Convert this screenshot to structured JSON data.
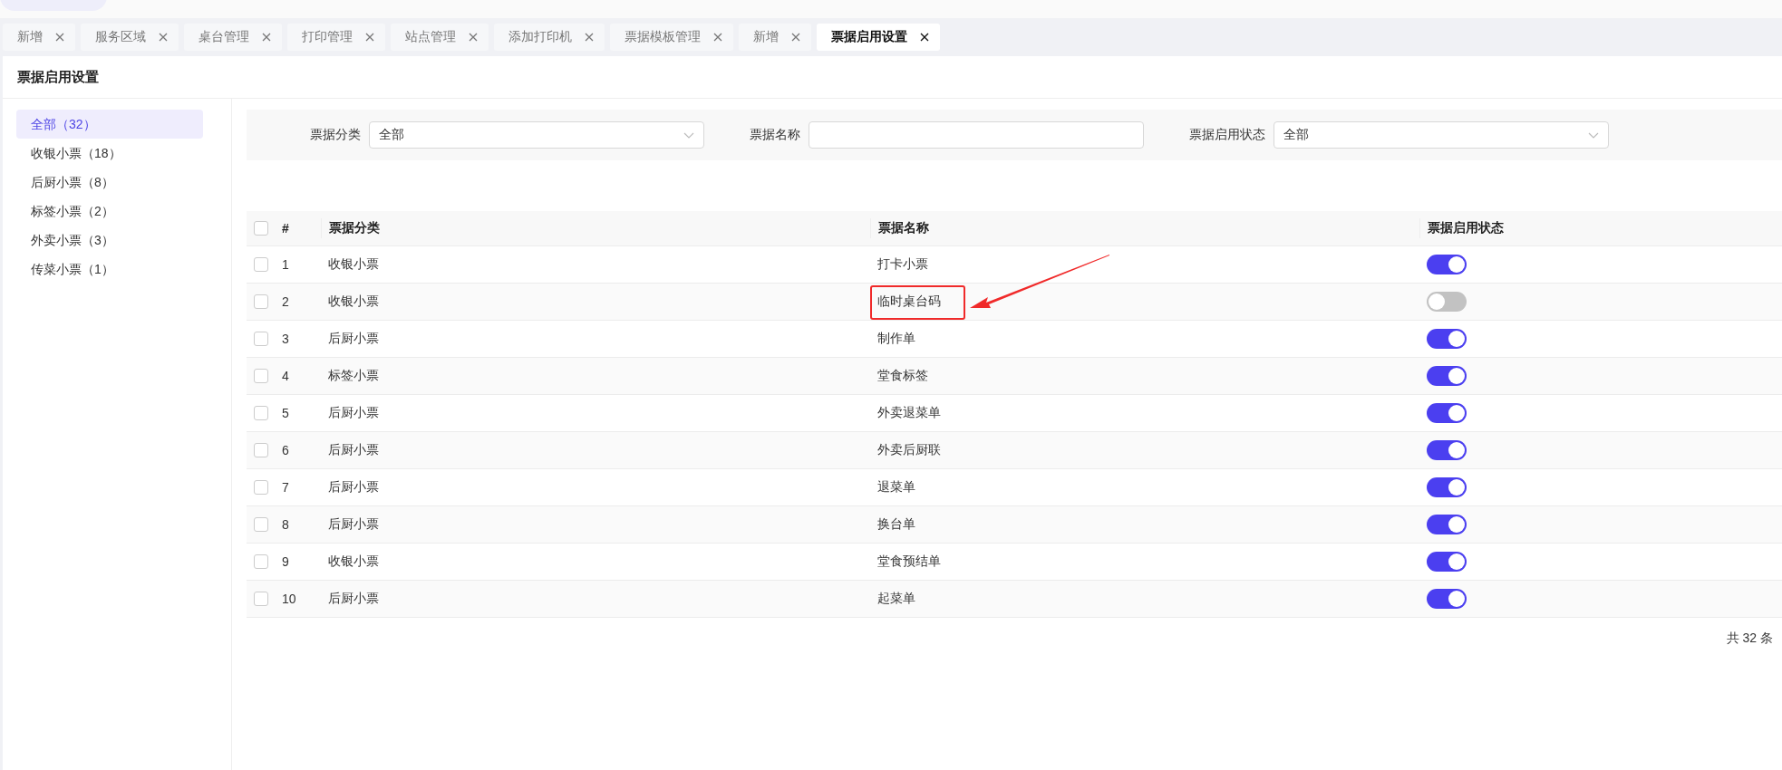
{
  "tabs": [
    {
      "label": "新增",
      "selected": false
    },
    {
      "label": "服务区域",
      "selected": false
    },
    {
      "label": "桌台管理",
      "selected": false
    },
    {
      "label": "打印管理",
      "selected": false
    },
    {
      "label": "站点管理",
      "selected": false
    },
    {
      "label": "添加打印机",
      "selected": false
    },
    {
      "label": "票据模板管理",
      "selected": false
    },
    {
      "label": "新增",
      "selected": false
    },
    {
      "label": "票据启用设置",
      "selected": true
    }
  ],
  "page_title": "票据启用设置",
  "sidebar": {
    "items": [
      {
        "label": "全部（32）",
        "selected": true
      },
      {
        "label": "收银小票（18）",
        "selected": false
      },
      {
        "label": "后厨小票（8）",
        "selected": false
      },
      {
        "label": "标签小票（2）",
        "selected": false
      },
      {
        "label": "外卖小票（3）",
        "selected": false
      },
      {
        "label": "传菜小票（1）",
        "selected": false
      }
    ]
  },
  "filters": [
    {
      "kind": "select",
      "label": "票据分类",
      "value": "全部"
    },
    {
      "kind": "input",
      "label": "票据名称"
    },
    {
      "kind": "select",
      "label": "票据启用状态",
      "value": "全部"
    }
  ],
  "table": {
    "select_all_checked": false,
    "columns": [
      "#",
      "票据分类",
      "票据名称",
      "票据启用状态"
    ],
    "rows": [
      {
        "checked": false,
        "index": "1",
        "category": "收银小票",
        "name": "打卡小票",
        "on": true,
        "annotated": false
      },
      {
        "checked": false,
        "index": "2",
        "category": "收银小票",
        "name": "临时桌台码",
        "on": false,
        "annotated": true
      },
      {
        "checked": false,
        "index": "3",
        "category": "后厨小票",
        "name": "制作单",
        "on": true,
        "annotated": false
      },
      {
        "checked": false,
        "index": "4",
        "category": "标签小票",
        "name": "堂食标签",
        "on": true,
        "annotated": false
      },
      {
        "checked": false,
        "index": "5",
        "category": "后厨小票",
        "name": "外卖退菜单",
        "on": true,
        "annotated": false
      },
      {
        "checked": false,
        "index": "6",
        "category": "后厨小票",
        "name": "外卖后厨联",
        "on": true,
        "annotated": false
      },
      {
        "checked": false,
        "index": "7",
        "category": "后厨小票",
        "name": "退菜单",
        "on": true,
        "annotated": false
      },
      {
        "checked": false,
        "index": "8",
        "category": "后厨小票",
        "name": "换台单",
        "on": true,
        "annotated": false
      },
      {
        "checked": false,
        "index": "9",
        "category": "收银小票",
        "name": "堂食预结单",
        "on": true,
        "annotated": false
      },
      {
        "checked": false,
        "index": "10",
        "category": "后厨小票",
        "name": "起菜单",
        "on": true,
        "annotated": false
      }
    ]
  },
  "total": "共 32 条"
}
